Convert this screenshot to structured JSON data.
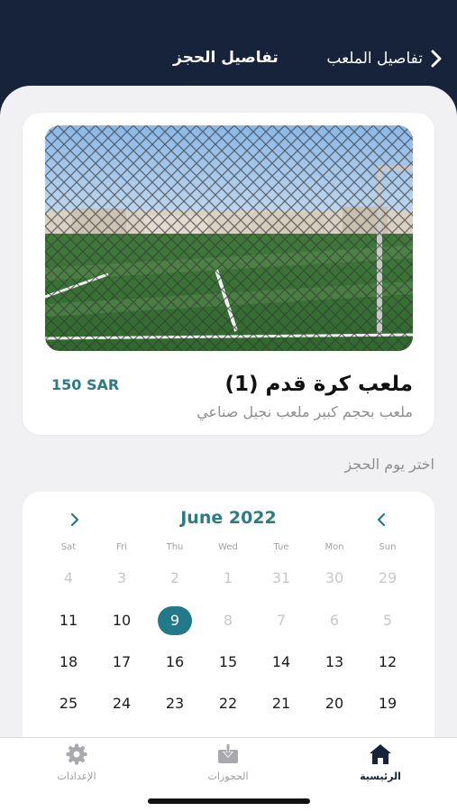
{
  "header": {
    "back_label": "تفاصيل الملعب",
    "title": "تفاصيل الحجز"
  },
  "court": {
    "name": "ملعب كرة قدم (1)",
    "price": "150 SAR",
    "description": "ملعب بحجم كبير ملعب نجيل صناعي"
  },
  "section_label": "اختر يوم الحجز",
  "calendar": {
    "month_title": "June 2022",
    "weekdays": [
      "Sat",
      "Fri",
      "Thu",
      "Wed",
      "Tue",
      "Mon",
      "Sun"
    ],
    "weeks": [
      [
        "4",
        "3",
        "2",
        "1",
        "31",
        "30",
        "29"
      ],
      [
        "11",
        "10",
        "9",
        "8",
        "7",
        "6",
        "5"
      ],
      [
        "18",
        "17",
        "16",
        "15",
        "14",
        "13",
        "12"
      ],
      [
        "25",
        "24",
        "23",
        "22",
        "21",
        "20",
        "19"
      ]
    ],
    "selected_day": "9"
  },
  "tabs": {
    "settings": "الإعدادات",
    "bookings": "الحجوزات",
    "home": "الرئيسية"
  },
  "colors": {
    "navy": "#17223b",
    "accent": "#2b7c86",
    "selected": "#23798a"
  }
}
